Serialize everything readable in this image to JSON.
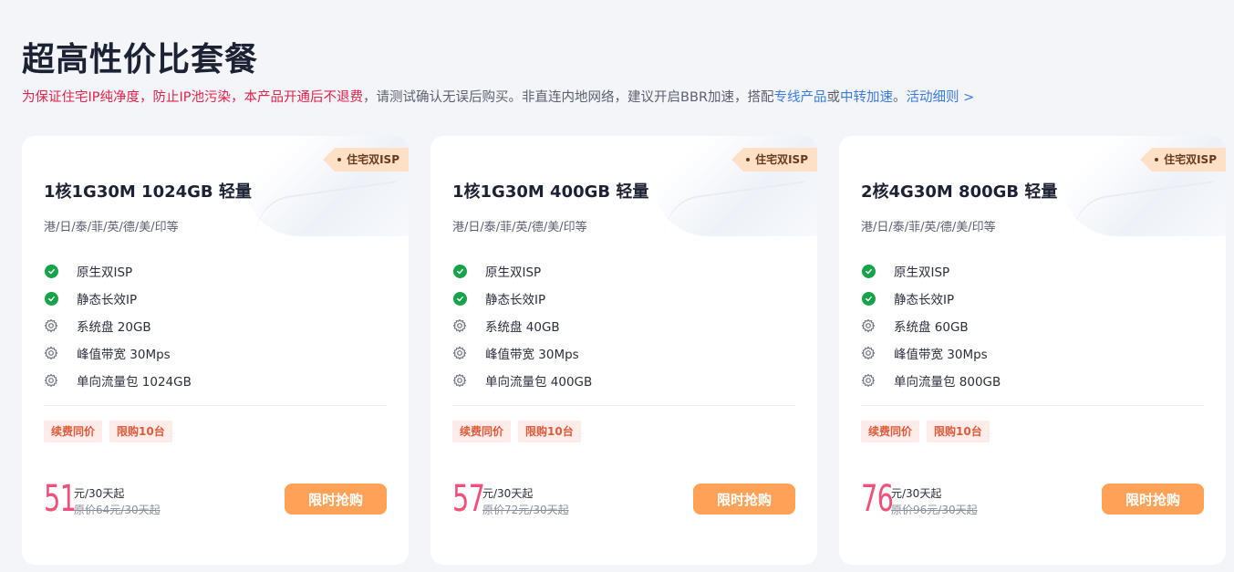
{
  "page": {
    "title": "超高性价比套餐",
    "notice": {
      "red_text": "为保证住宅IP纯净度，防止IP池污染，本产品开通后不退费",
      "text1": "，请测试确认无误后购买。非直连内地网络，建议开启BBR加速，搭配",
      "link1": "专线产品",
      "text2": "或",
      "link2": "中转加速",
      "text3": "。",
      "link3": "活动细则 >"
    }
  },
  "cards": [
    {
      "tag": "住宅双ISP",
      "title": "1核1G30M 1024GB 轻量",
      "regions": "港/日/泰/菲/英/德/美/印等",
      "features": [
        {
          "icon": "check-circle-icon",
          "label": "原生双ISP"
        },
        {
          "icon": "check-circle-icon",
          "label": "静态长效IP"
        },
        {
          "icon": "gear-icon",
          "label": "系统盘 20GB"
        },
        {
          "icon": "gear-icon",
          "label": "峰值带宽 30Mps"
        },
        {
          "icon": "gear-icon",
          "label": "单向流量包 1024GB"
        }
      ],
      "badges": [
        "续费同价",
        "限购10台"
      ],
      "price": "51",
      "unit": "元/30天起",
      "original": "原价64元/30天起",
      "buy_label": "限时抢购"
    },
    {
      "tag": "住宅双ISP",
      "title": "1核1G30M 400GB 轻量",
      "regions": "港/日/泰/菲/英/德/美/印等",
      "features": [
        {
          "icon": "check-circle-icon",
          "label": "原生双ISP"
        },
        {
          "icon": "check-circle-icon",
          "label": "静态长效IP"
        },
        {
          "icon": "gear-icon",
          "label": "系统盘 40GB"
        },
        {
          "icon": "gear-icon",
          "label": "峰值带宽 30Mps"
        },
        {
          "icon": "gear-icon",
          "label": "单向流量包 400GB"
        }
      ],
      "badges": [
        "续费同价",
        "限购10台"
      ],
      "price": "57",
      "unit": "元/30天起",
      "original": "原价72元/30天起",
      "buy_label": "限时抢购"
    },
    {
      "tag": "住宅双ISP",
      "title": "2核4G30M 800GB 轻量",
      "regions": "港/日/泰/菲/英/德/美/印等",
      "features": [
        {
          "icon": "check-circle-icon",
          "label": "原生双ISP"
        },
        {
          "icon": "check-circle-icon",
          "label": "静态长效IP"
        },
        {
          "icon": "gear-icon",
          "label": "系统盘 60GB"
        },
        {
          "icon": "gear-icon",
          "label": "峰值带宽 30Mps"
        },
        {
          "icon": "gear-icon",
          "label": "单向流量包 800GB"
        }
      ],
      "badges": [
        "续费同价",
        "限购10台"
      ],
      "price": "76",
      "unit": "元/30天起",
      "original": "原价96元/30天起",
      "buy_label": "限时抢购"
    }
  ],
  "colors": {
    "accent_red": "#e0224a",
    "link_blue": "#3a7be0",
    "price_pink": "#f0507a",
    "buy_orange": "#ffa257",
    "check_green": "#16a34a"
  }
}
